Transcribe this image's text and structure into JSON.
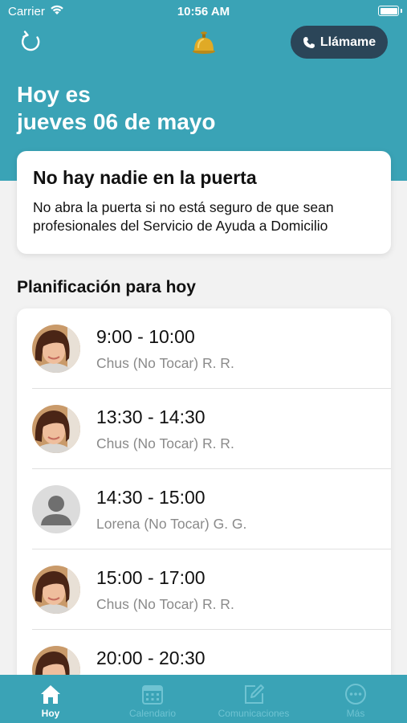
{
  "status_bar": {
    "carrier": "Carrier",
    "time": "10:56 AM"
  },
  "header": {
    "call_label": "Llámame",
    "greeting_line1": "Hoy es",
    "greeting_line2": "jueves 06 de mayo"
  },
  "alert": {
    "title": "No hay nadie en la puerta",
    "body": "No abra la puerta si no está seguro de que sean profesionales del Servicio de Ayuda a Domicilio"
  },
  "schedule": {
    "title": "Planificación para hoy",
    "items": [
      {
        "time": "9:00 - 10:00",
        "name": "Chus (No Tocar) R. R.",
        "avatar": "photo"
      },
      {
        "time": "13:30 - 14:30",
        "name": "Chus (No Tocar) R. R.",
        "avatar": "photo"
      },
      {
        "time": "14:30 - 15:00",
        "name": "Lorena (No Tocar) G. G.",
        "avatar": "placeholder"
      },
      {
        "time": "15:00 - 17:00",
        "name": "Chus (No Tocar) R. R.",
        "avatar": "photo"
      },
      {
        "time": "20:00 - 20:30",
        "name": "",
        "avatar": "photo"
      }
    ]
  },
  "tabs": [
    {
      "label": "Hoy",
      "icon": "home-icon",
      "active": true
    },
    {
      "label": "Calendario",
      "icon": "calendar-icon",
      "active": false
    },
    {
      "label": "Comunicaciones",
      "icon": "compose-icon",
      "active": false
    },
    {
      "label": "Más",
      "icon": "more-icon",
      "active": false
    }
  ],
  "colors": {
    "primary": "#3aa3b6",
    "call_button": "#2b4558",
    "inactive_tab": "#6fc3d2"
  }
}
